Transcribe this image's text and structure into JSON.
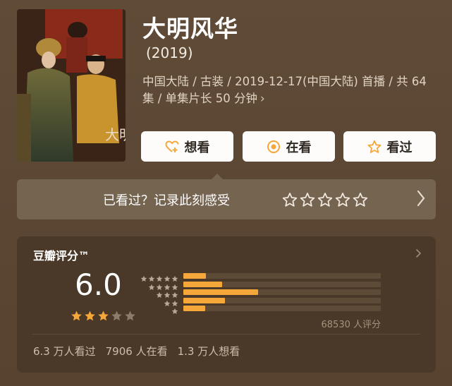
{
  "header": {
    "title": "大明风华",
    "year": "(2019)",
    "meta_line1": "中国大陆 / 古装 / 2019-12-17(中国大陆) 首播 / 共 64",
    "meta_line2": "集 / 单集片长 50 分钟",
    "meta_chevron": "›"
  },
  "actions": {
    "want_label": "想看",
    "watching_label": "在看",
    "watched_label": "看过"
  },
  "watched_prompt": {
    "label": "已看过？记录此刻感受",
    "star_count": 5
  },
  "rating": {
    "title": "豆瓣评分™",
    "score": "6.0",
    "stars_filled": 3,
    "stars_total": 5,
    "raters_text": "68530 人评分",
    "distribution": [
      {
        "stars": 5,
        "percent": 11.5
      },
      {
        "stars": 4,
        "percent": 19.5
      },
      {
        "stars": 3,
        "percent": 38
      },
      {
        "stars": 2,
        "percent": 21
      },
      {
        "stars": 1,
        "percent": 11
      }
    ],
    "watched_count": "6.3 万人看过",
    "watching_count": "7906 人在看",
    "want_count": "1.3 万人想看"
  },
  "colors": {
    "accent": "#f6a73a",
    "background": "#5e4a35",
    "card": "#4a3928"
  }
}
